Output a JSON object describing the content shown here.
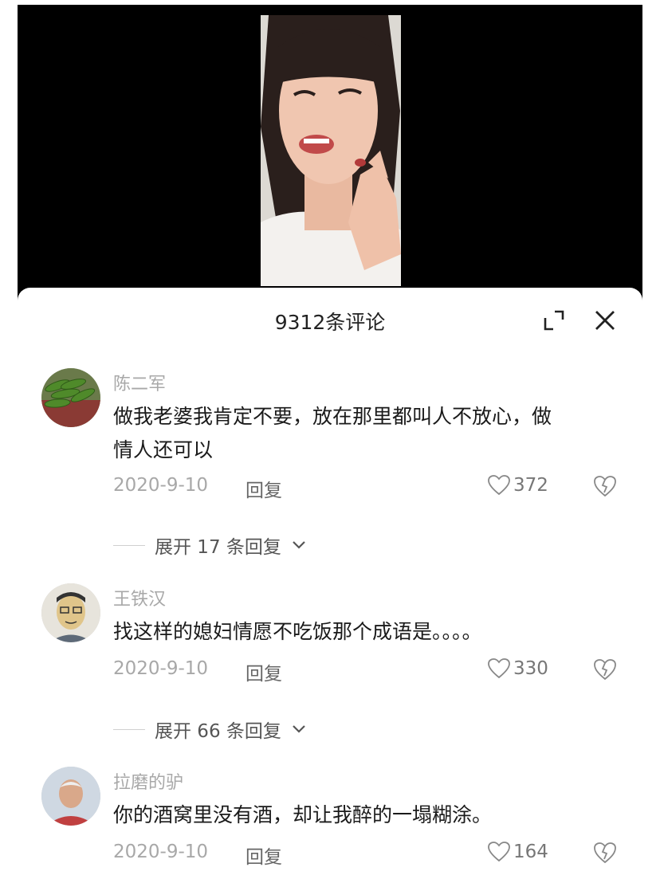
{
  "header": {
    "title": "9312条评论"
  },
  "comments": [
    {
      "user": "陈二军",
      "text": "做我老婆我肯定不要，放在那里都叫人不放心，做情人还可以",
      "date": "2020-9-10",
      "reply_label": "回复",
      "likes": "372",
      "expand_label": "展开 17 条回复"
    },
    {
      "user": "王铁汉",
      "text": "找这样的媳妇情愿不吃饭那个成语是。。。。",
      "date": "2020-9-10",
      "reply_label": "回复",
      "likes": "330",
      "expand_label": "展开 66 条回复"
    },
    {
      "user": "拉磨的驴",
      "text": "你的酒窝里没有酒，却让我醉的一塌糊涂。",
      "date": "2020-9-10",
      "reply_label": "回复",
      "likes": "164"
    }
  ],
  "colors": {
    "video_bg": "#000000",
    "sheet_bg": "#ffffff",
    "username": "#a8a8a8",
    "text": "#1a1a1a"
  },
  "icons": [
    "expand-icon",
    "close-icon",
    "heart-icon",
    "broken-heart-icon",
    "chevron-down-icon"
  ]
}
